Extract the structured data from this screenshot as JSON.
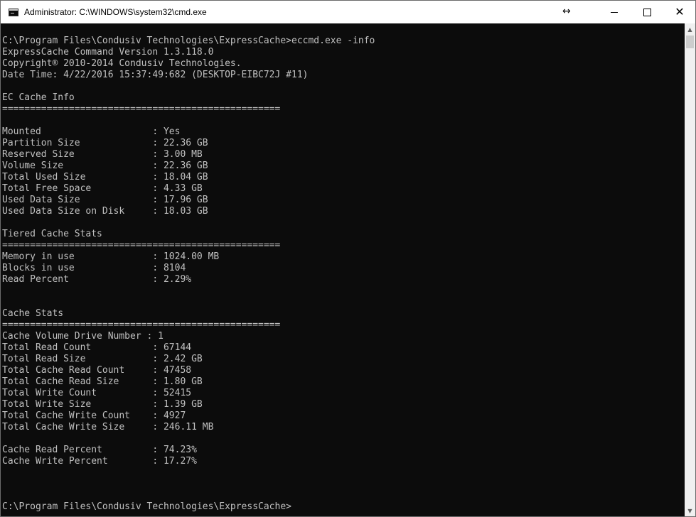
{
  "window": {
    "title": "Administrator: C:\\WINDOWS\\system32\\cmd.exe",
    "resize_glyph": "↔",
    "close_glyph": "✕"
  },
  "scrollbar": {
    "up_arrow": "▲",
    "down_arrow": "▼"
  },
  "console": {
    "lines": [
      "C:\\Program Files\\Condusiv Technologies\\ExpressCache>eccmd.exe -info",
      "ExpressCache Command Version 1.3.118.0",
      "Copyright® 2010-2014 Condusiv Technologies.",
      "Date Time: 4/22/2016 15:37:49:682 (DESKTOP-EIBC72J #11)",
      "",
      "EC Cache Info",
      "==================================================",
      "",
      "Mounted                    : Yes",
      "Partition Size             : 22.36 GB",
      "Reserved Size              : 3.00 MB",
      "Volume Size                : 22.36 GB",
      "Total Used Size            : 18.04 GB",
      "Total Free Space           : 4.33 GB",
      "Used Data Size             : 17.96 GB",
      "Used Data Size on Disk     : 18.03 GB",
      "",
      "Tiered Cache Stats",
      "==================================================",
      "Memory in use              : 1024.00 MB",
      "Blocks in use              : 8104",
      "Read Percent               : 2.29%",
      "",
      "",
      "Cache Stats",
      "==================================================",
      "Cache Volume Drive Number : 1",
      "Total Read Count           : 67144",
      "Total Read Size            : 2.42 GB",
      "Total Cache Read Count     : 47458",
      "Total Cache Read Size      : 1.80 GB",
      "Total Write Count          : 52415",
      "Total Write Size           : 1.39 GB",
      "Total Cache Write Count    : 4927",
      "Total Cache Write Size     : 246.11 MB",
      "",
      "Cache Read Percent         : 74.23%",
      "Cache Write Percent        : 17.27%",
      "",
      "",
      "",
      "C:\\Program Files\\Condusiv Technologies\\ExpressCache>"
    ]
  }
}
